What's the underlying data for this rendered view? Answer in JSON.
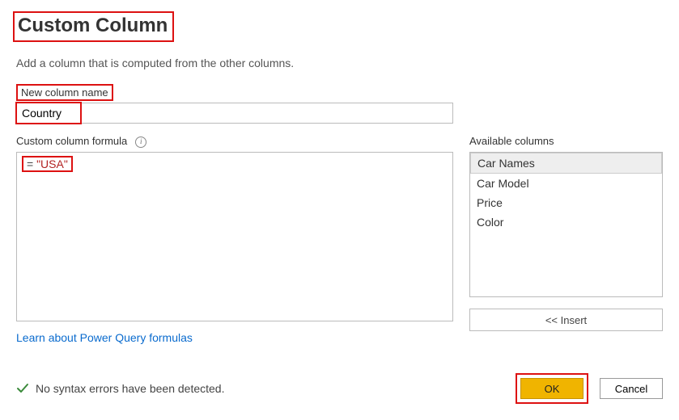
{
  "dialog": {
    "title": "Custom Column",
    "description": "Add a column that is computed from the other columns.",
    "name_label": "New column name",
    "name_value": "Country",
    "formula_label": "Custom column formula",
    "formula_eq": "= ",
    "formula_str": "\"USA\"",
    "available_label": "Available columns",
    "columns": [
      "Car Names",
      "Car Model",
      "Price",
      "Color"
    ],
    "selected_column_index": 0,
    "insert_label": "<< Insert",
    "link_text": "Learn about Power Query formulas",
    "status_text": "No syntax errors have been detected.",
    "ok_label": "OK",
    "cancel_label": "Cancel"
  }
}
